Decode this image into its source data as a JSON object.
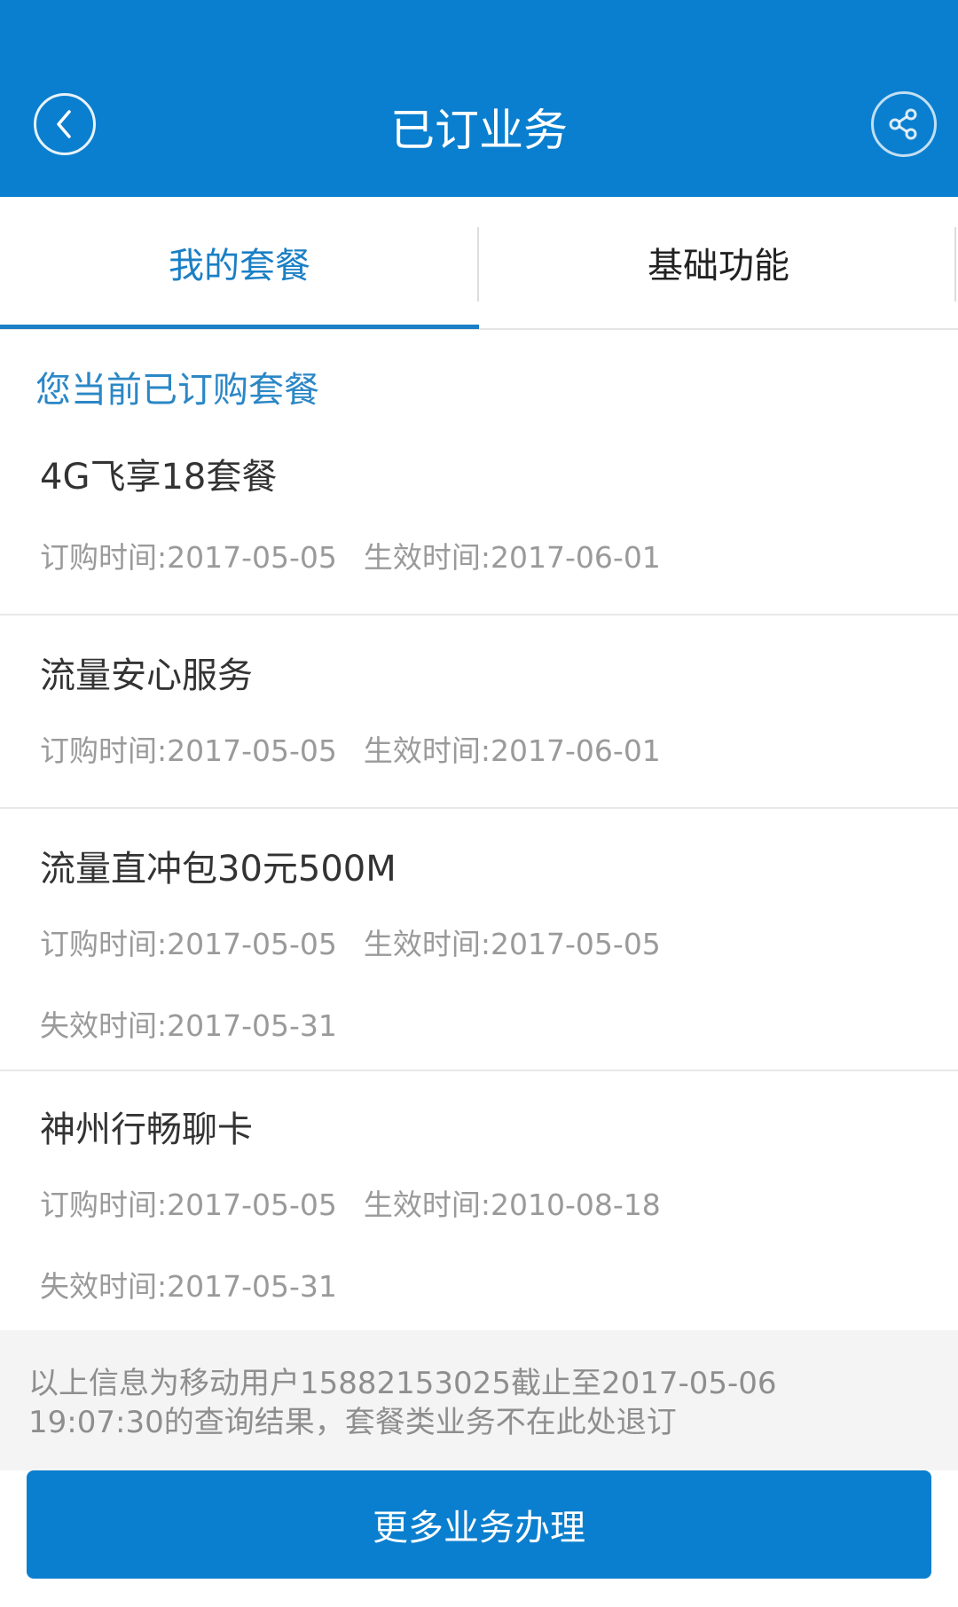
{
  "header": {
    "title": "已订业务",
    "back_icon": "back-icon",
    "share_icon": "share-icon",
    "background": "#0a7fcf"
  },
  "tabs": [
    {
      "label": "我的套餐",
      "active": true
    },
    {
      "label": "基础功能",
      "active": false
    }
  ],
  "section": {
    "heading": "您当前已订购套餐"
  },
  "packages": [
    {
      "name": "4G飞享18套餐",
      "order_time": "订购时间:2017-05-05",
      "effective_time": "生效时间:2017-06-01"
    },
    {
      "name": "流量安心服务",
      "order_time": "订购时间:2017-05-05",
      "effective_time": "生效时间:2017-06-01"
    },
    {
      "name": "流量直冲包30元500M",
      "order_time": "订购时间:2017-05-05",
      "effective_time": "生效时间:2017-05-05",
      "expiry_time": "失效时间:2017-05-31"
    },
    {
      "name": "神州行畅聊卡",
      "order_time": "订购时间:2017-05-05",
      "effective_time": "生效时间:2010-08-18",
      "expiry_time": "失效时间:2017-05-31"
    }
  ],
  "footer": {
    "note_line1": "以上信息为移动用户15882153025截止至2017-05-06",
    "note_line2": "19:07:30的查询结果，套餐类业务不在此处退订",
    "button_label": "更多业务办理"
  },
  "colors": {
    "accent": "#0a7fcf",
    "active_tab": "#1a7fc5"
  }
}
